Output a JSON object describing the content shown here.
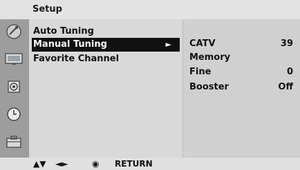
{
  "header": {
    "title": "Setup"
  },
  "sidebar": {
    "icons": [
      "satellite-dish-icon",
      "monitor-icon",
      "speaker-icon",
      "clock-icon",
      "toolbox-icon"
    ]
  },
  "menu": {
    "items": [
      {
        "label": "Auto Tuning",
        "selected": false
      },
      {
        "label": "Manual Tuning",
        "selected": true,
        "arrow": "►"
      },
      {
        "label": "Favorite Channel",
        "selected": false
      }
    ]
  },
  "submenu": {
    "rows": [
      {
        "label": "CATV",
        "value": "39"
      },
      {
        "label": "Memory",
        "value": ""
      },
      {
        "label": "Fine",
        "value": "0"
      },
      {
        "label": "Booster",
        "value": "Off"
      }
    ]
  },
  "footer": {
    "updown": "▲▼",
    "leftright": "◄►",
    "ok_icon": "◉",
    "return_label": "RETURN"
  },
  "colors": {
    "selected_bg": "#111111",
    "sidebar_bg": "#9d9d9d",
    "main_bg": "#d9d9d9",
    "right_bg": "#d0d0d0"
  }
}
